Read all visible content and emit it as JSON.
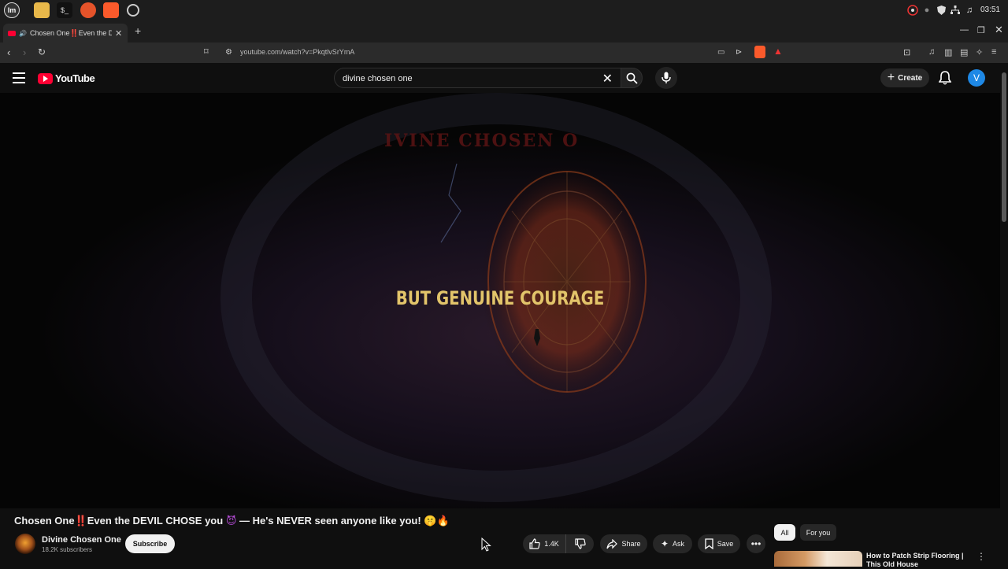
{
  "os_taskbar": {
    "apps": [
      "mint-menu-icon",
      "files-icon",
      "terminal-icon",
      "firefox-icon",
      "brave-icon",
      "chrome-icon"
    ],
    "clock": "03:51"
  },
  "browser": {
    "tab_title": "Chosen One‼️Even the DEVIL CHOSE",
    "url": "youtube.com/watch?v=PkqtlvSrYmA",
    "accent": "#ff0033"
  },
  "youtube": {
    "logo": "YouTube",
    "search_value": "divine chosen one",
    "create_label": "Create",
    "avatar_initial": "V",
    "avatar_color": "#1e88e5"
  },
  "video": {
    "overlay_title": "IVINE CHOSEN O",
    "caption": "BUT GENUINE COURAGE",
    "caption_color": "#e2c46a"
  },
  "watch": {
    "title_pre": "Chosen One",
    "title_bang": "‼️",
    "title_mid": "Even the DEVIL CHOSE you",
    "title_devil": "😈",
    "title_post": " — He's NEVER seen anyone like you! 🤫🔥",
    "channel": "Divine Chosen One",
    "subscribers": "18.2K subscribers",
    "subscribe_label": "Subscribe",
    "likes": "1.4K",
    "share_label": "Share",
    "ask_label": "Ask",
    "save_label": "Save"
  },
  "sidebar": {
    "chips": [
      "All",
      "For you"
    ],
    "rec_title": "How to Patch Strip Flooring | This Old House"
  }
}
